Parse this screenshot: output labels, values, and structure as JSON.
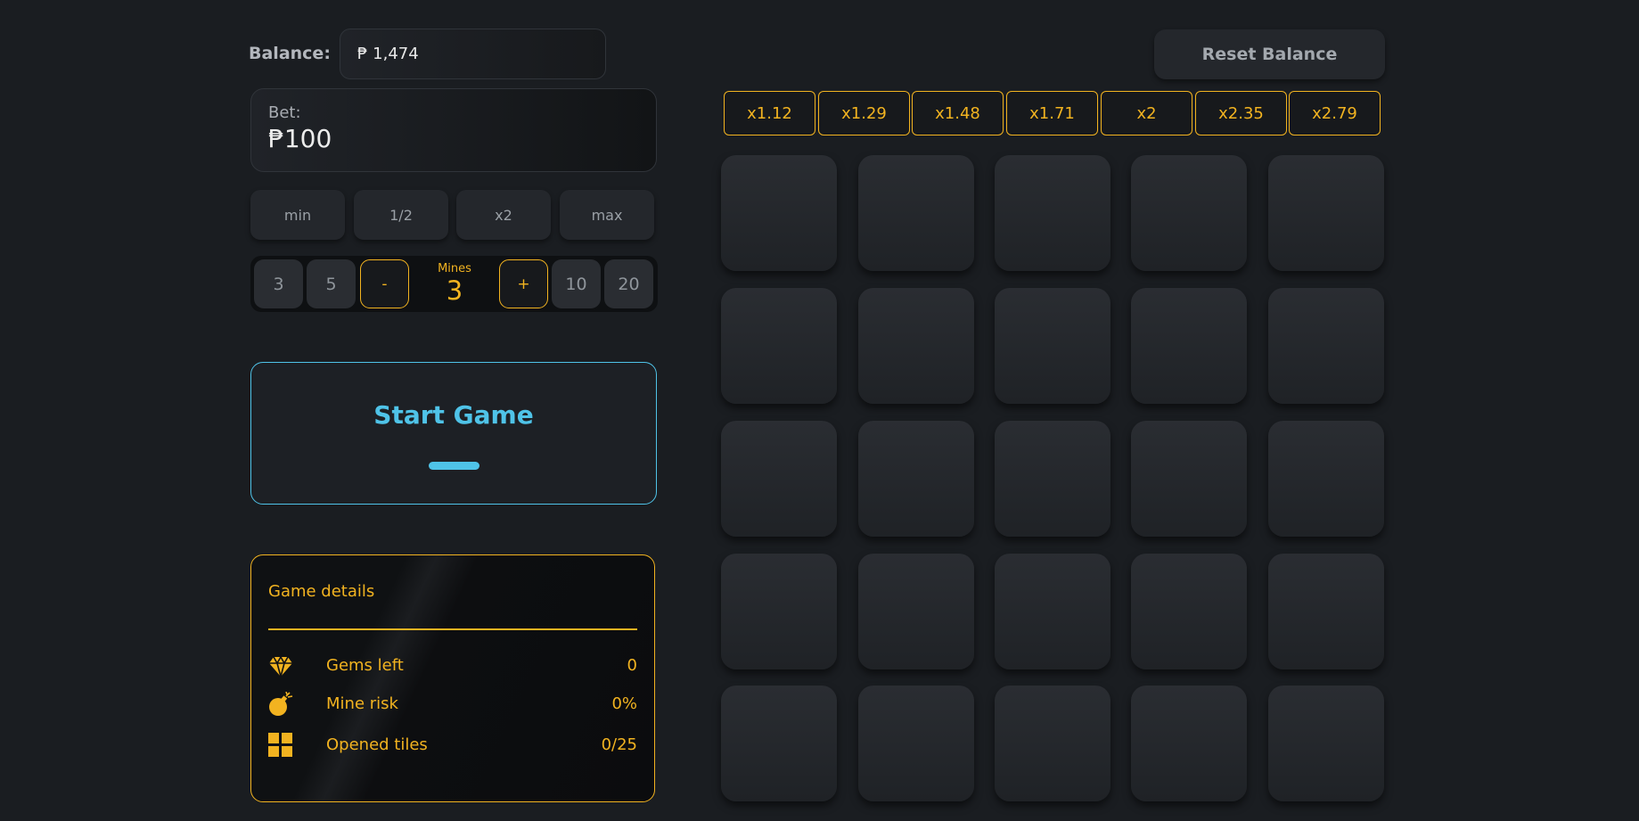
{
  "balance": {
    "label": "Balance:",
    "value": "₱ 1,474"
  },
  "bet": {
    "label": "Bet:",
    "value": "₱100"
  },
  "quick_bets": [
    "min",
    "1/2",
    "x2",
    "max"
  ],
  "mines": {
    "presets_left": [
      "3",
      "5"
    ],
    "decrement_label": "-",
    "caption": "Mines",
    "count": "3",
    "increment_label": "+",
    "presets_right": [
      "10",
      "20"
    ]
  },
  "start_button": {
    "label": "Start Game"
  },
  "game_details": {
    "title": "Game details",
    "rows": [
      {
        "icon": "gem-icon",
        "label": "Gems left",
        "value": "0"
      },
      {
        "icon": "bomb-icon",
        "label": "Mine risk",
        "value": "0%"
      },
      {
        "icon": "grid-icon",
        "label": "Opened tiles",
        "value": "0/25"
      }
    ]
  },
  "reset_button": {
    "label": "Reset Balance"
  },
  "multipliers": [
    "x1.12",
    "x1.29",
    "x1.48",
    "x1.71",
    "x2",
    "x2.35",
    "x2.79"
  ],
  "board": {
    "rows": 5,
    "cols": 5
  },
  "colors": {
    "background": "#1a1d21",
    "accent": "#f2b320",
    "start": "#4fc3e8",
    "tile": "#2a2d32"
  }
}
